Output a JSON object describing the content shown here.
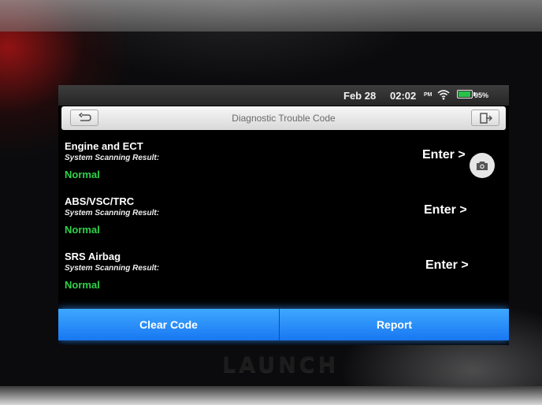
{
  "status_bar": {
    "date": "Feb 28",
    "time": "02:02",
    "ampm": "PM",
    "battery_pct": "95%",
    "battery_level": 0.95,
    "wifi_icon": "wifi-icon",
    "battery_icon": "battery-icon"
  },
  "title_bar": {
    "title": "Diagnostic Trouble Code",
    "back_icon": "back-arrow-icon",
    "exit_icon": "exit-icon"
  },
  "systems": [
    {
      "name": "Engine and ECT",
      "scan_label": "System Scanning Result:",
      "status": "Normal",
      "enter_label": "Enter >"
    },
    {
      "name": "ABS/VSC/TRC",
      "scan_label": "System Scanning Result:",
      "status": "Normal",
      "enter_label": "Enter >"
    },
    {
      "name": "SRS Airbag",
      "scan_label": "System Scanning Result:",
      "status": "Normal",
      "enter_label": "Enter >"
    }
  ],
  "status_color": "#2fd24a",
  "screenshot_icon": "camera-icon",
  "footer": {
    "clear_label": "Clear Code",
    "report_label": "Report",
    "button_color": "#1877f2"
  },
  "device_brand": "LAUNCH"
}
